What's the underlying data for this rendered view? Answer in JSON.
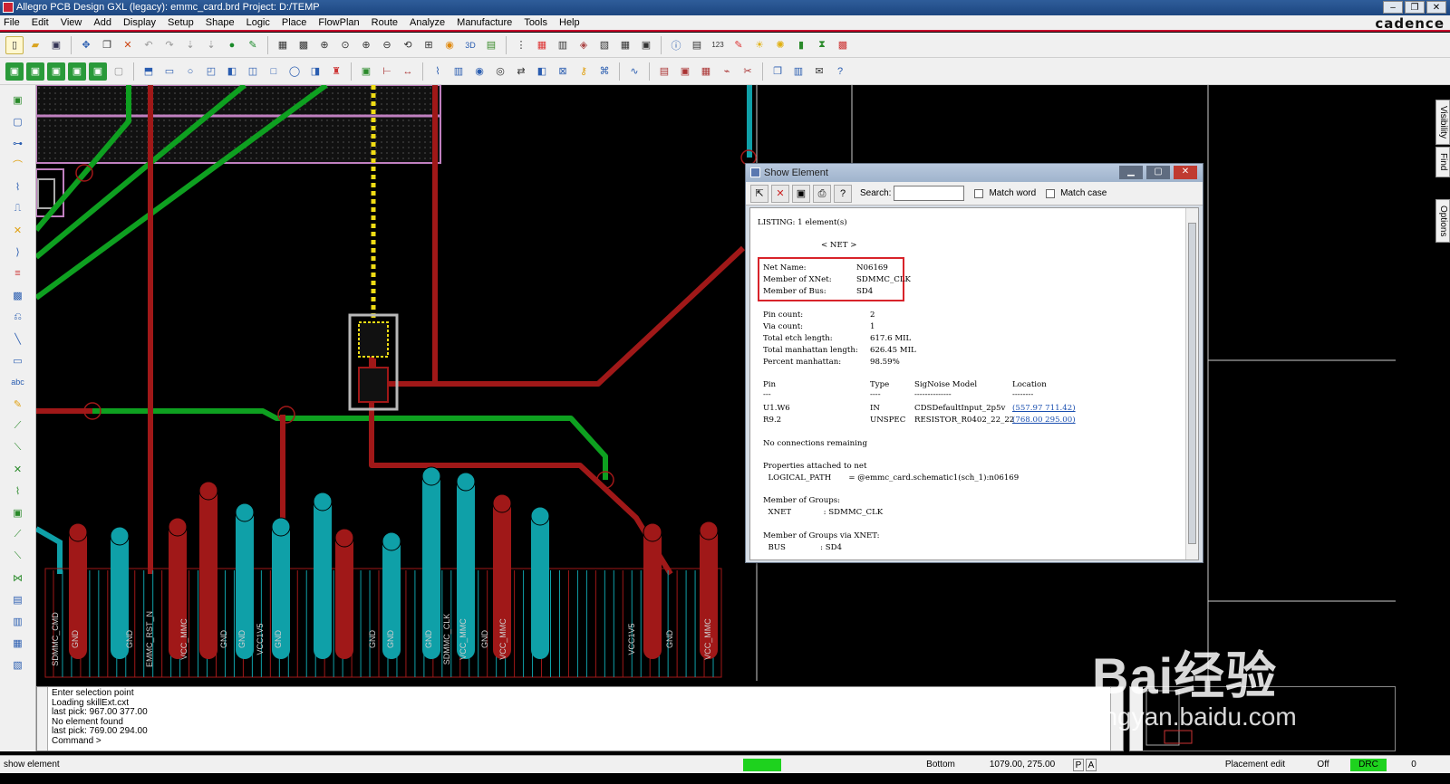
{
  "window": {
    "title": "Allegro PCB Design GXL (legacy): emmc_card.brd  Project: D:/TEMP",
    "brand": "cadence"
  },
  "menu": [
    "File",
    "Edit",
    "View",
    "Add",
    "Display",
    "Setup",
    "Shape",
    "Logic",
    "Place",
    "FlowPlan",
    "Route",
    "Analyze",
    "Manufacture",
    "Tools",
    "Help"
  ],
  "right_tabs": [
    "Visibility",
    "Find",
    "Options"
  ],
  "pcb": {
    "pin_labels": [
      "SDMMC_CMD",
      "GND",
      "GND",
      "EMMC_RST_N",
      "VCC_MMC",
      "GND",
      "GND",
      "VCC1V5",
      "GND",
      "GND",
      "GND",
      "GND",
      "SDMMC_CLK",
      "VCC_MMC",
      "GND",
      "VCC_MMC",
      "VCC1V5",
      "GND",
      "VCC_MMC"
    ],
    "colors": {
      "top_copper": "#a01818",
      "bottom_copper": "#0fa0a8",
      "green_net": "#0ea020",
      "yellow": "#f0dc14",
      "outline": "#c080c0"
    }
  },
  "dialog": {
    "title": "Show Element",
    "search_label": "Search:",
    "search_value": "",
    "match_word": "Match word",
    "match_case": "Match case",
    "listing": "LISTING: 1 element(s)",
    "net_header": "< NET >",
    "net_props": [
      {
        "k": "Net Name:",
        "v": "N06169"
      },
      {
        "k": "Member of XNet:",
        "v": "SDMMC_CLK"
      },
      {
        "k": "Member of Bus:",
        "v": "SD4"
      }
    ],
    "stats": [
      {
        "k": "Pin count:",
        "v": "2"
      },
      {
        "k": "Via count:",
        "v": "1"
      },
      {
        "k": "Total etch length:",
        "v": "617.6 MIL"
      },
      {
        "k": "Total manhattan length:",
        "v": "626.45 MIL"
      },
      {
        "k": "Percent manhattan:",
        "v": "98.59%"
      }
    ],
    "pin_table": {
      "headers": [
        "Pin",
        "Type",
        "SigNoise Model",
        "Location"
      ],
      "dashes": [
        "---",
        "----",
        "--------------",
        "--------"
      ],
      "rows": [
        {
          "pin": "U1.W6",
          "type": "IN",
          "model": "CDSDefaultInput_2p5v",
          "loc": "(557.97 711.42)"
        },
        {
          "pin": "R9.2",
          "type": "UNSPEC",
          "model": "RESISTOR_R0402_22_22",
          "loc": "(768.00 295.00)"
        }
      ]
    },
    "no_conn": "No connections remaining",
    "props_title": "Properties attached to net",
    "props_line": "  LOGICAL_PATH       = @emmc_card.schematic1(sch_1):n06169",
    "groups_title": "Member of Groups:",
    "groups_line": "  XNET             : SDMMC_CLK",
    "groups_xnet_title": "Member of Groups via XNET:",
    "groups_xnet_line": "  BUS              : SD4"
  },
  "command": {
    "lines": [
      "Enter selection point",
      "Loading skillExt.cxt",
      "last pick:  967.00  377.00",
      "No element found",
      "last pick:  769.00  294.00",
      "Command >"
    ]
  },
  "status": {
    "message": "show element",
    "layer": "Bottom",
    "coords": "1079.00, 275.00",
    "p": "P",
    "a": "A",
    "mode": "Placement edit",
    "off": "Off",
    "drc": "DRC",
    "count": "0"
  },
  "watermark": {
    "main": "Bai经验",
    "sub": "jingyan.baidu.com"
  }
}
